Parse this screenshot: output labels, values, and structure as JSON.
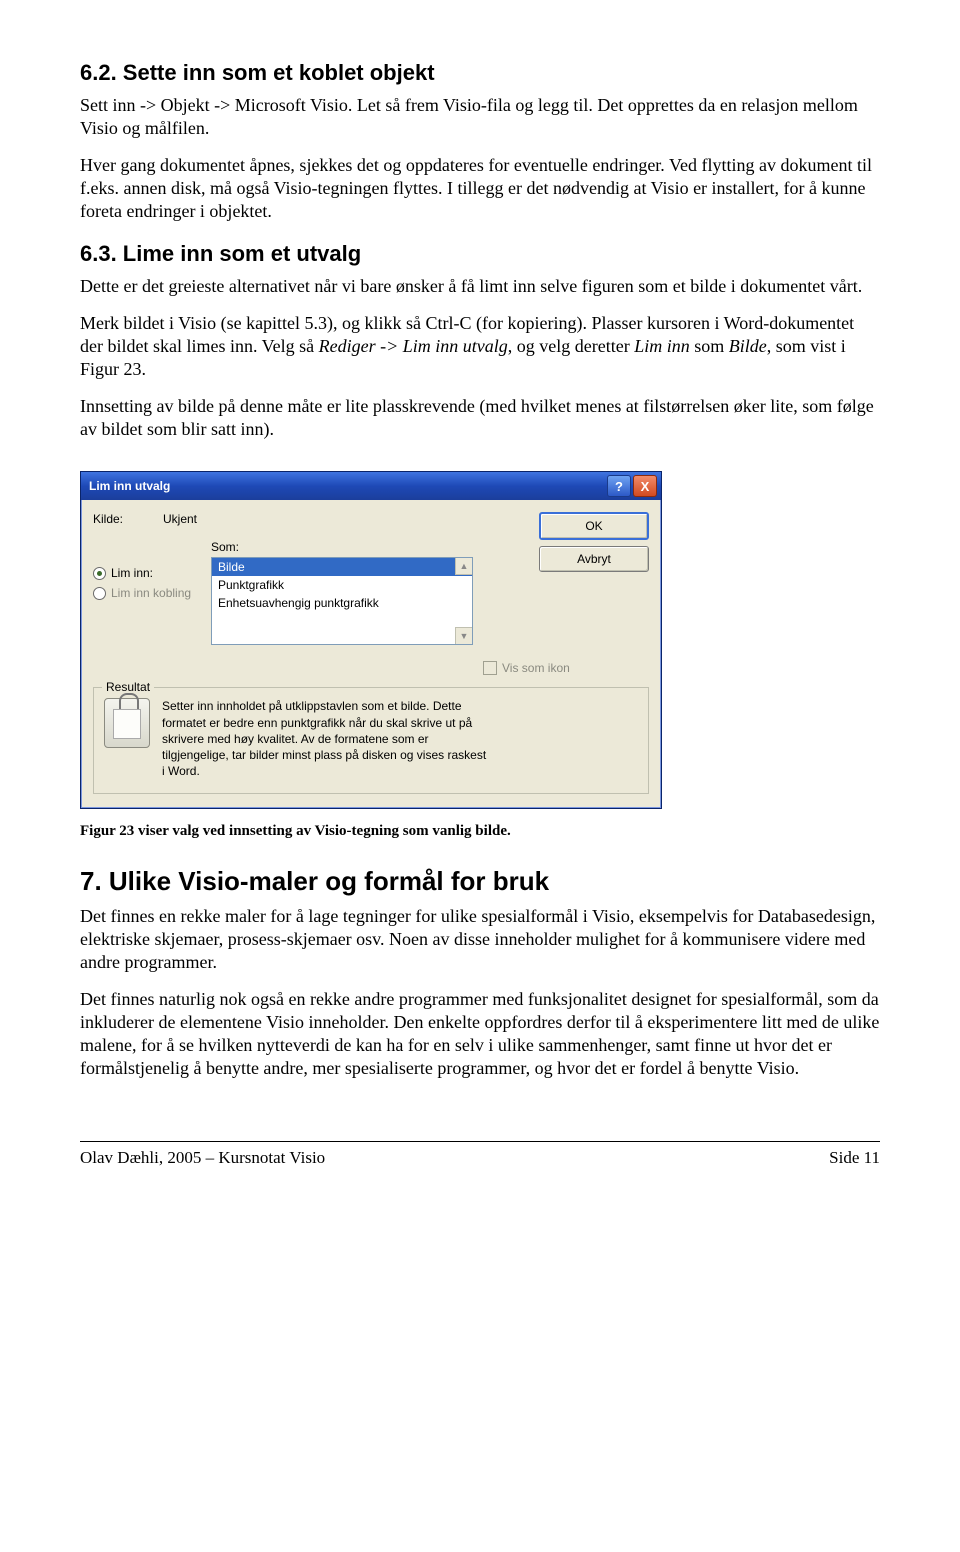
{
  "section62": {
    "heading": "6.2.   Sette inn som et koblet objekt",
    "p1": "Sett inn -> Objekt -> Microsoft Visio. Let så frem Visio-fila og legg til. Det opprettes da en relasjon mellom Visio og målfilen.",
    "p2": "Hver gang dokumentet åpnes, sjekkes det og oppdateres for eventuelle endringer. Ved flytting av dokument til f.eks. annen disk, må også Visio-tegningen flyttes. I tillegg er det nødvendig at Visio er installert, for å kunne foreta endringer i objektet."
  },
  "section63": {
    "heading": "6.3.   Lime inn som et utvalg",
    "p1": "Dette er det greieste alternativet når vi bare ønsker å få limt inn selve figuren som et bilde i dokumentet vårt.",
    "p2a": "Merk bildet i Visio (se kapittel 5.3), og klikk så Ctrl-C (for kopiering). Plasser kursoren i Word-dokumentet der bildet skal limes inn. Velg så ",
    "p2b_i": "Rediger -> Lim inn utvalg",
    "p2c": ", og velg deretter ",
    "p2d_i": "Lim inn",
    "p2e": " som ",
    "p2f_i": "Bilde",
    "p2g": ", som vist i Figur 23.",
    "p3": "Innsetting av bilde på denne måte er lite plasskrevende (med hvilket menes at filstørrelsen øker lite, som følge av bildet som blir satt inn)."
  },
  "dialog": {
    "title": "Lim inn utvalg",
    "help": "?",
    "close": "X",
    "kilde_label": "Kilde:",
    "kilde_value": "Ukjent",
    "som_label": "Som:",
    "ok": "OK",
    "avbryt": "Avbryt",
    "radio_liminn": "Lim inn:",
    "radio_limkobling": "Lim inn kobling",
    "options": [
      "Bilde",
      "Punktgrafikk",
      "Enhetsuavhengig punktgrafikk"
    ],
    "vis_som_ikon": "Vis som ikon",
    "resultat_legend": "Resultat",
    "resultat_text": "Setter inn innholdet på utklippstavlen som et bilde. Dette formatet er bedre enn punktgrafikk når du skal skrive ut på skrivere med høy kvalitet. Av de formatene som er tilgjengelige, tar bilder minst plass på disken og vises raskest i Word."
  },
  "caption": "Figur 23 viser valg ved innsetting av Visio-tegning som vanlig bilde.",
  "section7": {
    "heading": "7. Ulike Visio-maler og formål for bruk",
    "p1": "Det finnes en rekke maler for å lage tegninger for ulike spesialformål i Visio, eksempelvis for Databasedesign, elektriske skjemaer, prosess-skjemaer osv. Noen av disse inneholder mulighet for å kommunisere videre med andre programmer.",
    "p2": "Det finnes naturlig nok også en rekke andre programmer med funksjonalitet designet for spesialformål, som da inkluderer de elementene Visio inneholder. Den enkelte oppfordres derfor til å eksperimentere litt med de ulike malene, for å se hvilken nytteverdi de kan ha for en selv i ulike sammenhenger, samt finne ut hvor det er formålstjenelig å benytte andre, mer spesialiserte programmer, og hvor det er fordel å benytte Visio."
  },
  "footer": {
    "left": "Olav Dæhli, 2005 – Kursnotat Visio",
    "right": "Side 11"
  }
}
